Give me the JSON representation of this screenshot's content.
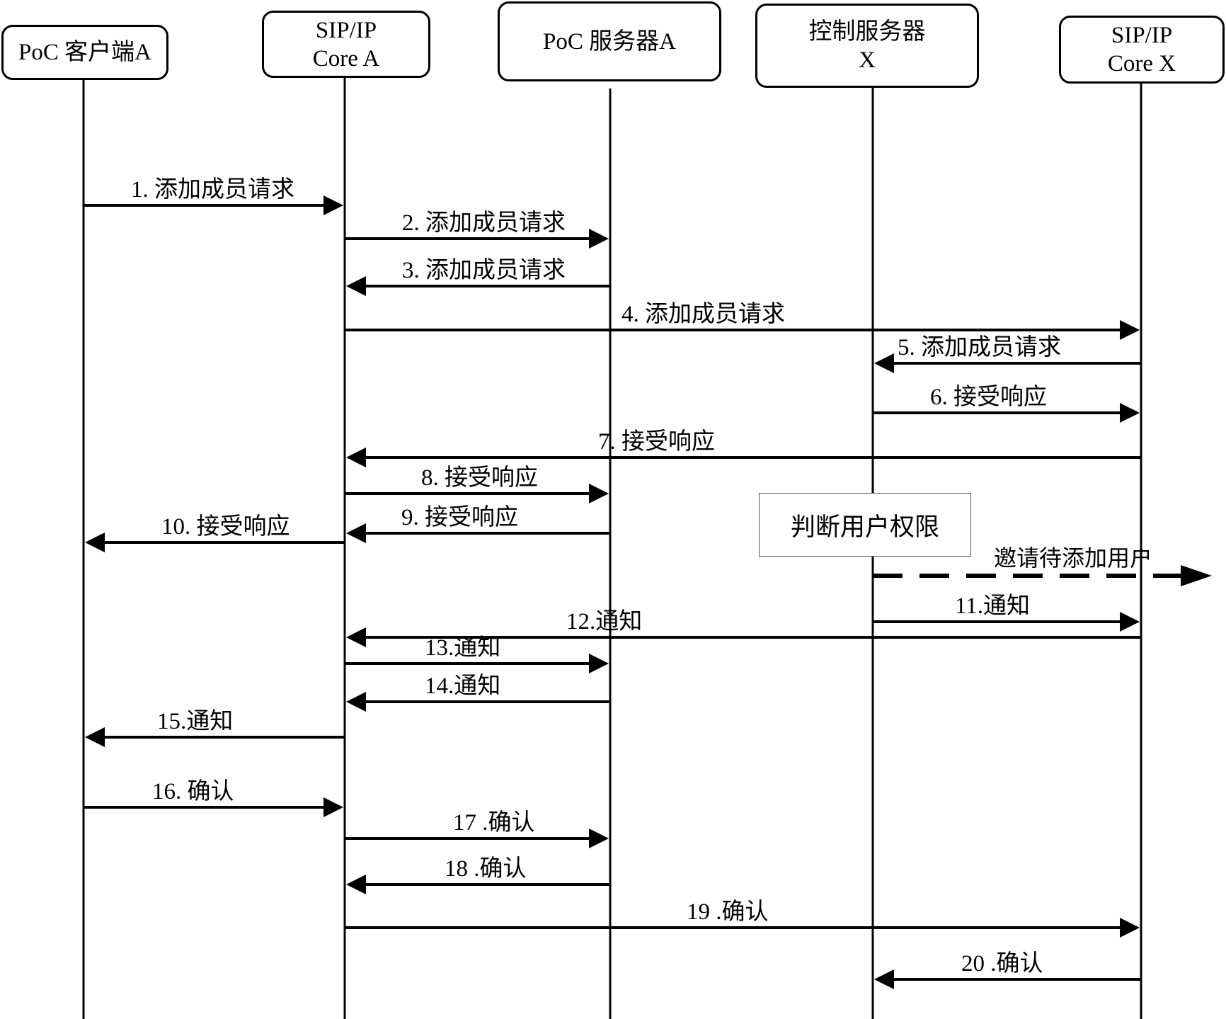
{
  "participants": [
    {
      "id": "client_a",
      "label": "PoC 客户端A"
    },
    {
      "id": "core_a",
      "label": "SIP/IP\nCore A"
    },
    {
      "id": "poc_server_a",
      "label": "PoC 服务器A"
    },
    {
      "id": "control_server_x",
      "label": "控制服务器\nX"
    },
    {
      "id": "core_x",
      "label": "SIP/IP\nCore X"
    }
  ],
  "note": {
    "label": "判断用户权限"
  },
  "external_message": {
    "label": "邀请待添加用户",
    "style": "dashed"
  },
  "messages": [
    {
      "from": "client_a",
      "to": "core_a",
      "label": "1. 添加成员请求"
    },
    {
      "from": "core_a",
      "to": "poc_server_a",
      "label": "2. 添加成员请求"
    },
    {
      "from": "poc_server_a",
      "to": "core_a",
      "label": "3. 添加成员请求"
    },
    {
      "from": "core_a",
      "to": "core_x",
      "label": "4. 添加成员请求"
    },
    {
      "from": "core_x",
      "to": "control_server_x",
      "label": "5. 添加成员请求"
    },
    {
      "from": "control_server_x",
      "to": "core_x",
      "label": "6. 接受响应"
    },
    {
      "from": "core_x",
      "to": "core_a",
      "label": "7. 接受响应"
    },
    {
      "from": "core_a",
      "to": "poc_server_a",
      "label": "8. 接受响应"
    },
    {
      "from": "poc_server_a",
      "to": "core_a",
      "label": "9. 接受响应"
    },
    {
      "from": "core_a",
      "to": "client_a",
      "label": "10. 接受响应"
    },
    {
      "from": "control_server_x",
      "to": "core_x",
      "label": "11.通知"
    },
    {
      "from": "core_x",
      "to": "core_a",
      "label": "12.通知"
    },
    {
      "from": "core_a",
      "to": "poc_server_a",
      "label": "13.通知"
    },
    {
      "from": "poc_server_a",
      "to": "core_a",
      "label": "14.通知"
    },
    {
      "from": "core_a",
      "to": "client_a",
      "label": "15.通知"
    },
    {
      "from": "client_a",
      "to": "core_a",
      "label": "16. 确认"
    },
    {
      "from": "core_a",
      "to": "poc_server_a",
      "label": "17 .确认"
    },
    {
      "from": "poc_server_a",
      "to": "core_a",
      "label": "18 .确认"
    },
    {
      "from": "core_a",
      "to": "core_x",
      "label": "19 .确认"
    },
    {
      "from": "core_x",
      "to": "control_server_x",
      "label": "20 .确认"
    }
  ]
}
